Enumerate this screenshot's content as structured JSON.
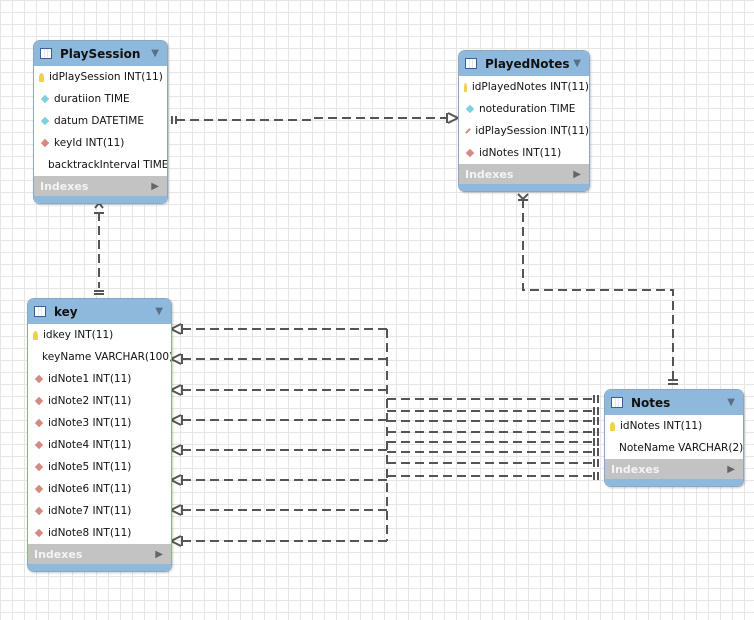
{
  "tables": {
    "playsession": {
      "name": "PlaySession",
      "indexes": "Indexes",
      "columns": [
        {
          "text": "idPlaySession INT(11)",
          "kind": "primary-key"
        },
        {
          "text": "duratiion TIME",
          "kind": "column"
        },
        {
          "text": "datum DATETIME",
          "kind": "column"
        },
        {
          "text": "keyId INT(11)",
          "kind": "foreign-key"
        },
        {
          "text": "backtrackInterval TIME",
          "kind": "column"
        }
      ]
    },
    "playednotes": {
      "name": "PlayedNotes",
      "indexes": "Indexes",
      "columns": [
        {
          "text": "idPlayedNotes INT(11)",
          "kind": "primary-key"
        },
        {
          "text": "noteduration TIME",
          "kind": "column"
        },
        {
          "text": "idPlaySession INT(11)",
          "kind": "foreign-key"
        },
        {
          "text": "idNotes INT(11)",
          "kind": "foreign-key"
        }
      ]
    },
    "key": {
      "name": "key",
      "indexes": "Indexes",
      "columns": [
        {
          "text": "idkey INT(11)",
          "kind": "primary-key"
        },
        {
          "text": "keyName VARCHAR(100)",
          "kind": "column"
        },
        {
          "text": "idNote1 INT(11)",
          "kind": "foreign-key"
        },
        {
          "text": "idNote2 INT(11)",
          "kind": "foreign-key"
        },
        {
          "text": "idNote3 INT(11)",
          "kind": "foreign-key"
        },
        {
          "text": "idNote4 INT(11)",
          "kind": "foreign-key"
        },
        {
          "text": "idNote5 INT(11)",
          "kind": "foreign-key"
        },
        {
          "text": "idNote6 INT(11)",
          "kind": "foreign-key"
        },
        {
          "text": "idNote7 INT(11)",
          "kind": "foreign-key"
        },
        {
          "text": "idNote8 INT(11)",
          "kind": "foreign-key"
        }
      ]
    },
    "notes": {
      "name": "Notes",
      "indexes": "Indexes",
      "columns": [
        {
          "text": "idNotes INT(11)",
          "kind": "primary-key"
        },
        {
          "text": "NoteName VARCHAR(2)",
          "kind": "column"
        }
      ]
    }
  },
  "relationships": [
    {
      "from": "PlaySession",
      "to": "PlayedNotes",
      "cardinality": "one-to-many"
    },
    {
      "from": "PlaySession",
      "to": "key",
      "cardinality": "many-to-one"
    },
    {
      "from": "PlayedNotes",
      "to": "Notes",
      "cardinality": "many-to-one"
    },
    {
      "from": "key",
      "to": "Notes",
      "cardinality": "many-to-one",
      "count": 8
    }
  ],
  "colors": {
    "header": "#8fb9dc",
    "indexes": "#c3c3c3",
    "line": "#555555"
  }
}
